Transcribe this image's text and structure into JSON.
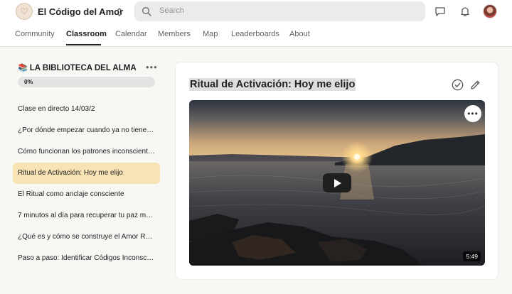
{
  "header": {
    "app_title": "El Código del Amor",
    "search_placeholder": "Search",
    "icons": [
      "logo-icon",
      "switcher-icon",
      "search-icon",
      "chat-icon",
      "bell-icon",
      "avatar"
    ]
  },
  "tabs": [
    {
      "label": "Community"
    },
    {
      "label": "Classroom",
      "active": true
    },
    {
      "label": "Calendar"
    },
    {
      "label": "Members"
    },
    {
      "label": "Map"
    },
    {
      "label": "Leaderboards"
    },
    {
      "label": "About"
    }
  ],
  "sidebar": {
    "book_icon": "📚",
    "course_title": "LA BIBLIOTECA DEL ALMA",
    "progress_label": "0%",
    "progress_value": 0,
    "lessons": [
      {
        "label": "Clase en directo 14/03/2"
      },
      {
        "label": "¿Por dónde empezar cuando ya no tienes …"
      },
      {
        "label": "Cómo funcionan los patrones inconscient…"
      },
      {
        "label": "Ritual de Activación: Hoy me elijo",
        "active": true
      },
      {
        "label": "El Ritual como anclaje consciente"
      },
      {
        "label": "7 minutos al día para recuperar tu paz me…"
      },
      {
        "label": "¿Qué es y cómo se construye el Amor Real?"
      },
      {
        "label": "Paso a paso: Identificar Códigos Inconsci…"
      }
    ]
  },
  "main": {
    "lesson_title": "Ritual de Activación: Hoy me elijo",
    "video_duration": "5:49"
  },
  "colors": {
    "active_lesson_bg": "#f8e3b4",
    "accent_text": "#202124"
  }
}
